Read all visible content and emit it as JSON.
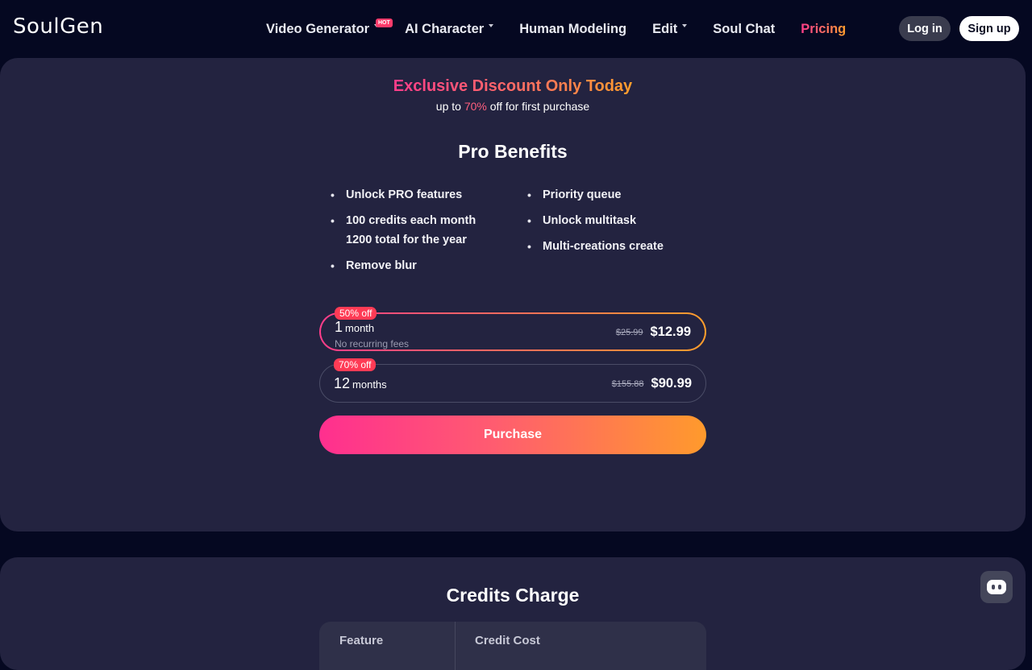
{
  "header": {
    "logo": "SoulGen",
    "nav": [
      {
        "label": "Video Generator",
        "dropdown": true,
        "badge": "HOT"
      },
      {
        "label": "AI Character",
        "dropdown": true
      },
      {
        "label": "Human Modeling",
        "dropdown": false
      },
      {
        "label": "Edit",
        "dropdown": true
      },
      {
        "label": "Soul Chat",
        "dropdown": false
      },
      {
        "label": "Pricing",
        "dropdown": false,
        "active": true
      }
    ],
    "login_label": "Log in",
    "signup_label": "Sign up"
  },
  "promo": {
    "title": "Exclusive Discount Only Today",
    "subtitle_prefix": "up to",
    "subtitle_percent": "70%",
    "subtitle_suffix": "off for first purchase"
  },
  "benefits": {
    "title": "Pro Benefits",
    "left": [
      [
        "Unlock PRO features"
      ],
      [
        "100 credits each month",
        "1200 total for the year"
      ],
      [
        "Remove blur"
      ]
    ],
    "right": [
      [
        "Priority queue"
      ],
      [
        "Unlock multitask"
      ],
      [
        "Multi-creations create"
      ]
    ]
  },
  "plans": [
    {
      "badge": "50% off",
      "period_number": "1",
      "period_unit": "month",
      "note": "No recurring fees",
      "old_price": "$25.99",
      "new_price": "$12.99",
      "selected": true
    },
    {
      "badge": "70% off",
      "period_number": "12",
      "period_unit": "months",
      "note": "",
      "old_price": "$155.88",
      "new_price": "$90.99",
      "selected": false
    }
  ],
  "purchase_label": "Purchase",
  "credits": {
    "title": "Credits Charge",
    "columns": [
      "Feature",
      "Credit Cost"
    ]
  },
  "colors": {
    "background": "#050821",
    "card": "#232340",
    "accent_pink": "#ff3d8b",
    "accent_orange": "#ff9e2c",
    "badge_red": "#ff3b55"
  },
  "icons": {
    "chat_widget": "chat-bot-icon",
    "dropdown": "chevron-down-icon"
  }
}
